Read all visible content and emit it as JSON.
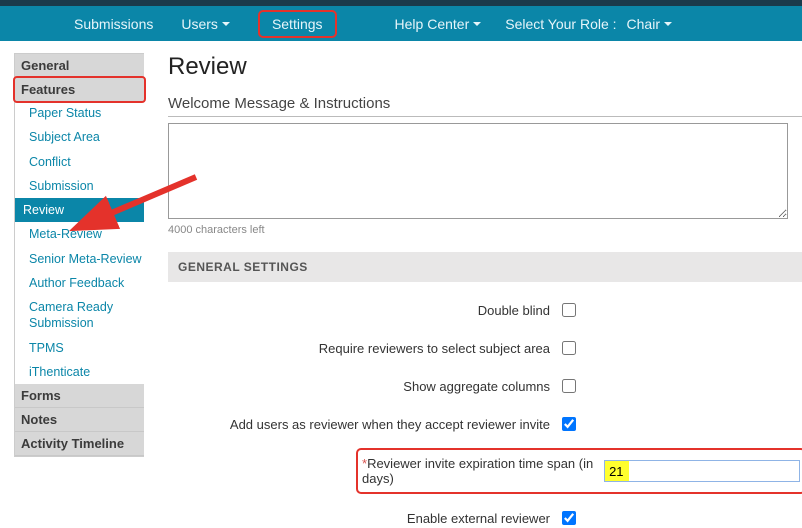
{
  "nav": {
    "submissions": "Submissions",
    "users": "Users",
    "settings": "Settings",
    "help": "Help Center",
    "rolelabel": "Select Your Role :",
    "role": "Chair"
  },
  "sidebar": {
    "general": "General",
    "features": "Features",
    "subs": {
      "paper_status": "Paper Status",
      "subject_area": "Subject Area",
      "conflict": "Conflict",
      "submission": "Submission",
      "review": "Review",
      "meta_review": "Meta-Review",
      "senior_meta_review": "Senior Meta-Review",
      "author_feedback": "Author Feedback",
      "camera_ready": "Camera Ready Submission",
      "tpms": "TPMS",
      "ithenticate": "iThenticate"
    },
    "forms": "Forms",
    "notes": "Notes",
    "activity": "Activity Timeline"
  },
  "page": {
    "title": "Review",
    "welcome_label": "Welcome Message & Instructions",
    "welcome_value": "",
    "chars_left": "4000 characters left",
    "general_settings": "GENERAL SETTINGS",
    "rows": {
      "double_blind": "Double blind",
      "require_subject": "Require reviewers to select subject area",
      "show_aggregate": "Show aggregate columns",
      "add_reviewer_on_accept": "Add users as reviewer when they accept reviewer invite",
      "expire_label": "Reviewer invite expiration time span (in days)",
      "expire_value": "21",
      "enable_external": "Enable external reviewer"
    }
  }
}
